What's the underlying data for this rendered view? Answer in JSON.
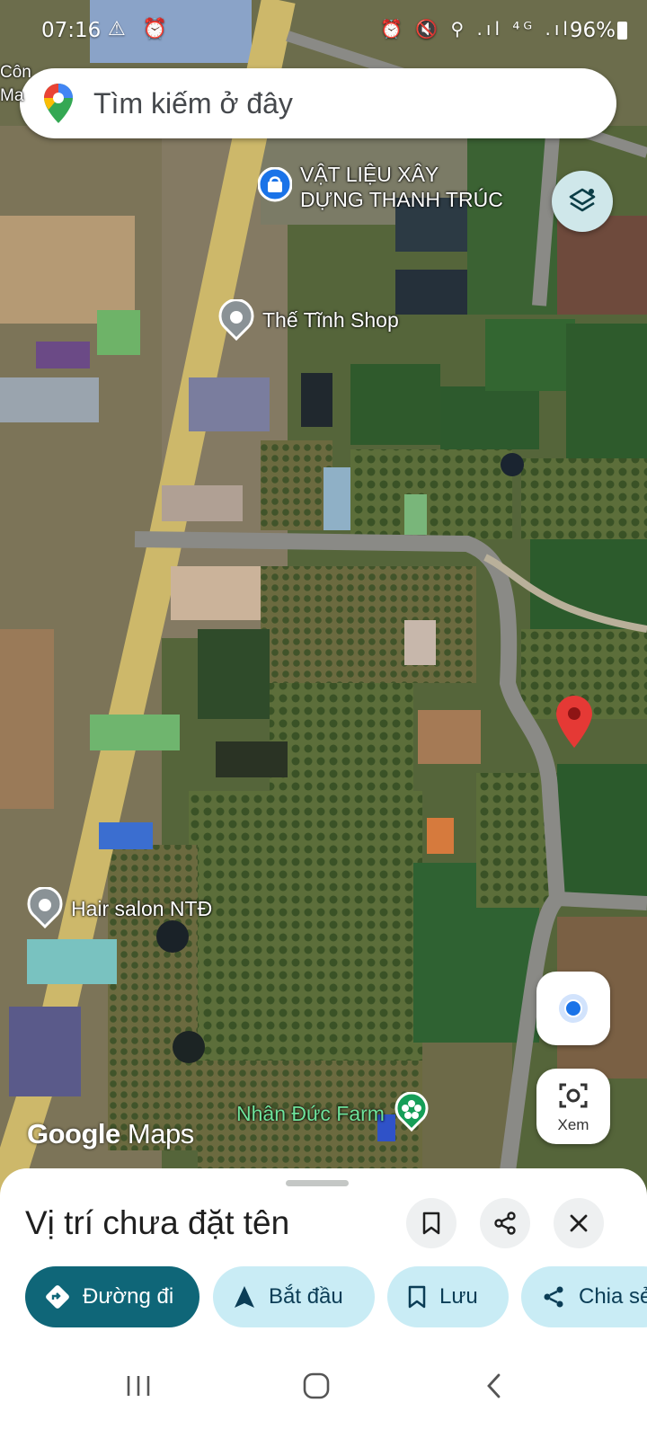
{
  "status_bar": {
    "time": "07:16",
    "left_icons": "⚠ ⏰",
    "right_icons": "⏰ 🔇 ⚲ .ıl ⁴ᴳ .ıl",
    "battery": "96%"
  },
  "search": {
    "placeholder": "Tìm kiếm ở đây"
  },
  "map_labels": {
    "store_line1": "VẬT LIỆU XÂY",
    "store_line2": "DỰNG THANH TRÚC",
    "shop": "Thế Tĩnh Shop",
    "hair_salon": "Hair salon NTĐ",
    "farm": "Nhân Đức Farm",
    "edge_top": "Côn",
    "edge_mid": "Ma"
  },
  "attribution": {
    "google": "Google",
    "maps": "Maps"
  },
  "lens_button": {
    "label": "Xem"
  },
  "sheet": {
    "title": "Vị trí chưa đặt tên",
    "chips": [
      {
        "label": "Đường đi",
        "icon": "directions-icon"
      },
      {
        "label": "Bắt đầu",
        "icon": "navigation-arrow-icon"
      },
      {
        "label": "Lưu",
        "icon": "bookmark-icon"
      },
      {
        "label": "Chia sẻ",
        "icon": "share-icon"
      }
    ]
  },
  "colors": {
    "primary_chip": "#0f6678",
    "secondary_chip": "#c9ecf5",
    "pin_red": "#e53935",
    "road_yellow": "#cdb86a",
    "farm_green": "#6fe39b"
  }
}
